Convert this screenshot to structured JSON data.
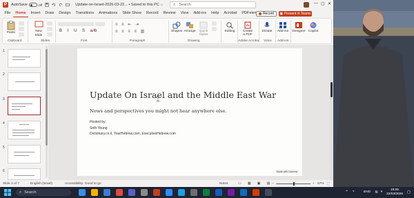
{
  "titlebar": {
    "autosave_label": "AutoSave",
    "autosave_state": "Off",
    "doc_title": "Update-on-Israel-2026-03-22... • Saved to this PC ⌵",
    "search_placeholder": "Search",
    "minimize": "—",
    "maximize": "▢",
    "close": "✕"
  },
  "ribbon_tabs": [
    "File",
    "Home",
    "Insert",
    "Draw",
    "Design",
    "Transitions",
    "Animations",
    "Slide Show",
    "Record",
    "Review",
    "View",
    "Add-ins",
    "Help",
    "Acrobat",
    "PDFelement"
  ],
  "active_tab": "Home",
  "record_button": "Record",
  "present_button": "Present in Teams",
  "ribbon": {
    "clipboard": {
      "paste": "Paste",
      "label": "Clipboard"
    },
    "slides": {
      "new_slide": "New Slide",
      "label": "Slides"
    },
    "font": {
      "label": "Font"
    },
    "paragraph": {
      "label": "Paragraph"
    },
    "drawing": {
      "shapes": "Shapes",
      "arrange": "Arrange",
      "quick_styles": "Quick Styles",
      "label": "Drawing"
    },
    "editing": {
      "editing": "Editing"
    },
    "acrobat": {
      "create_pdf": "Create a PDF",
      "label": "Adobe Acrobat"
    },
    "voice": {
      "dictate": "Dictate",
      "label": "Voice"
    },
    "addins": {
      "addins": "Add-ins",
      "label": "Add-ins"
    },
    "designer": "Designer",
    "copilot": "Copilot"
  },
  "thumbnails": [
    {
      "num": "1"
    },
    {
      "num": "2"
    },
    {
      "num": "3"
    },
    {
      "num": "4"
    },
    {
      "num": "5"
    },
    {
      "num": "6"
    }
  ],
  "slide": {
    "title": "Update On Israel and the Middle East War",
    "subtitle": "News and perspectives you might not hear anywhere else.",
    "hosted_by": "Hosted by:",
    "host": "Seth Young",
    "sites": "Dictionary.co.il, YourHebrew.com, ExecutiveHebrew.com",
    "badge": "Made with Gamma"
  },
  "statusbar": {
    "slide_count": "Slide 3 of 7",
    "language": "English (Israel)",
    "accessibility": "Accessibility: Good to go",
    "notes": "Notes",
    "zoom": "57%"
  },
  "taskbar": {
    "search": "Search",
    "lang": "ENG",
    "time": "19:06",
    "date": "22/03/2026"
  },
  "colors": {
    "accent": "#c43e1c",
    "active_thumb": "#a4262c"
  }
}
